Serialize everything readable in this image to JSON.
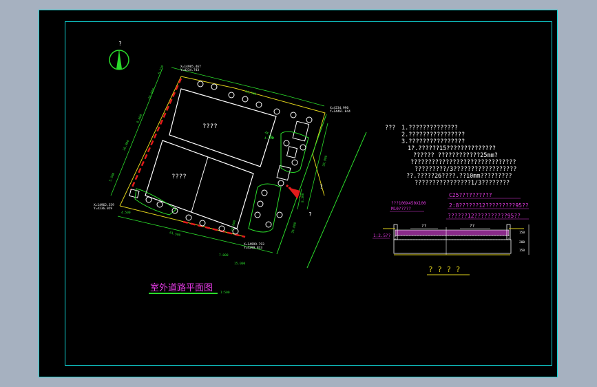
{
  "colors": {
    "border": "#10d5d6",
    "boundary": "#e0d21b",
    "road": "#2bdc2b",
    "building": "#ffffff",
    "fence": "#e31b1b",
    "tree": "#ffffff",
    "magenta": "#e23ae2",
    "text_white": "#ffffff",
    "gate": "#e31b1b"
  },
  "north": {
    "label": "?"
  },
  "plan": {
    "title": "室外道路平面图",
    "scale": "1:500",
    "building_a": "????",
    "building_b": "????",
    "coord_top": [
      "X=14985.467",
      "Y=4234.743"
    ],
    "coord_right": [
      "X=4234.990",
      "Y=14461.044"
    ],
    "coord_left": [
      "X=14962.359",
      "Y=4236.059"
    ],
    "coord_bottom": [
      "X=14999.793",
      "Y=4299.833"
    ],
    "dims": {
      "d1": "6.150",
      "d2": "26.000",
      "d3": "8.000",
      "d4": "26.000",
      "d5": "5.500",
      "d6": "16.000",
      "d7": "61.500",
      "d8": "61.500",
      "d9": "4.500",
      "d10": "7.000",
      "d11": "15.000",
      "d12": "20.000",
      "d13": "8.300",
      "d14": "4.100",
      "d15": "18.000",
      "d16": "26.000"
    },
    "road_marks": [
      "?",
      "?"
    ]
  },
  "notes": {
    "heading": "???",
    "lines": [
      "1.??????????????",
      "2.????????????????",
      "3.????????????????",
      "1?.??????15??????????????",
      "??????  ????????????25mm?",
      "??????????????????????????????",
      "?????????/3??????????????????",
      "??.?????26????.??10mm?????????",
      "????????????????1/3????????"
    ]
  },
  "section": {
    "top_label": "C25??????????",
    "layer1": "2:8??????12?????????95??",
    "layer2": "??????12??????????95??",
    "left_label_1": "???100X450X100",
    "left_label_2": "M10?????",
    "bottom_left": "1:2.5??",
    "center_label_1": "??",
    "center_label_2": "??",
    "right_dims": [
      "150",
      "200",
      "150"
    ],
    "title": "? ? ? ?"
  }
}
